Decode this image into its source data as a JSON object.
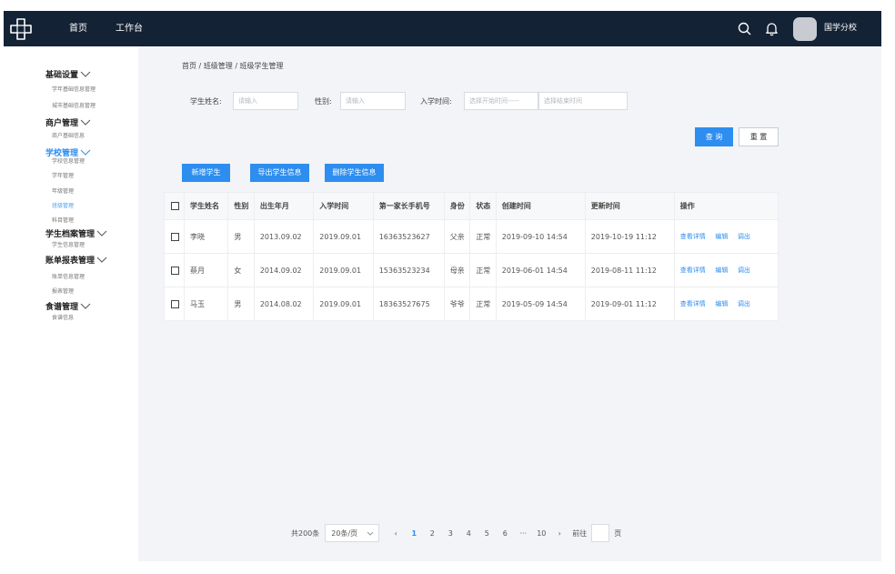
{
  "topbar": {
    "nav": [
      "首页",
      "工作台"
    ],
    "school_name": "国学分校",
    "bg_color": "#142235"
  },
  "sidebar": {
    "groups": [
      {
        "label": "基础设置",
        "items": [
          "学年基础信息管理",
          "城市基础信息管理"
        ]
      },
      {
        "label": "商户管理",
        "items": [
          "商户基础信息"
        ]
      },
      {
        "label": "学校管理",
        "items": [
          "学校信息管理",
          "学年管理",
          "年级管理",
          "班级管理",
          "科目管理"
        ]
      },
      {
        "label": "学生档案管理",
        "items": [
          "学生信息管理"
        ]
      },
      {
        "label": "账单报表管理",
        "items": [
          "账单信息管理",
          "报表管理"
        ]
      },
      {
        "label": "食谱管理",
        "items": [
          "食谱信息"
        ]
      }
    ],
    "active_group": "学校管理",
    "active_item": "班级管理"
  },
  "breadcrumb": "首页 / 班级管理 / 班级学生管理",
  "filters": {
    "name_label": "学生姓名:",
    "name_placeholder": "请输入",
    "gender_label": "性别:",
    "gender_placeholder": "请输入",
    "date_label": "入学时间:",
    "date_start_placeholder": "选择开始时间-----",
    "date_end_placeholder": "选择结束时间"
  },
  "buttons": {
    "query": "查 询",
    "reset": "重 置",
    "add": "新增学生",
    "export": "导出学生信息",
    "delete": "删除学生信息"
  },
  "table": {
    "headers": [
      "学生姓名",
      "性别",
      "出生年月",
      "入学时间",
      "第一家长手机号",
      "身份",
      "状态",
      "创建时间",
      "更新时间",
      "操作"
    ],
    "rows": [
      {
        "name": "李晓",
        "gender": "男",
        "birth": "2013.09.02",
        "enroll": "2019.09.01",
        "phone": "16363523627",
        "identity": "父亲",
        "status": "正常",
        "created": "2019-09-10 14:54",
        "updated": "2019-10-19 11:12"
      },
      {
        "name": "蔡月",
        "gender": "女",
        "birth": "2014.09.02",
        "enroll": "2019.09.01",
        "phone": "15363523234",
        "identity": "母亲",
        "status": "正常",
        "created": "2019-06-01 14:54",
        "updated": "2019-08-11 11:12"
      },
      {
        "name": "马玉",
        "gender": "男",
        "birth": "2014.08.02",
        "enroll": "2019.09.01",
        "phone": "18363527675",
        "identity": "爷爷",
        "status": "正常",
        "created": "2019-05-09 14:54",
        "updated": "2019-09-01 11:12"
      }
    ],
    "actions": [
      "查看详情",
      "编辑",
      "调出"
    ]
  },
  "pagination": {
    "total": "共200条",
    "page_size": "20条/页",
    "pages": [
      "1",
      "2",
      "3",
      "4",
      "5",
      "6",
      "···",
      "10"
    ],
    "current": "1",
    "prev": "‹",
    "next": "›",
    "goto_label": "前往",
    "goto_suffix": "页"
  },
  "colors": {
    "accent": "#2e8ef0"
  }
}
